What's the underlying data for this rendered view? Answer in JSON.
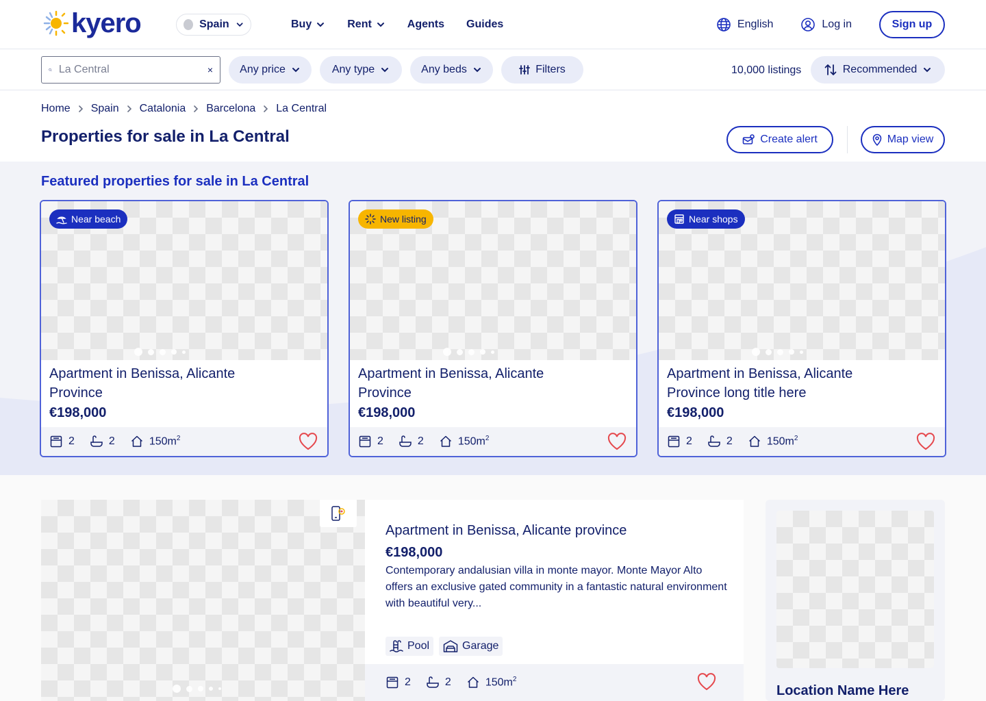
{
  "header": {
    "logo": "kyero",
    "country": "Spain",
    "nav": [
      {
        "label": "Buy",
        "has_dropdown": true
      },
      {
        "label": "Rent",
        "has_dropdown": true
      },
      {
        "label": "Agents",
        "has_dropdown": false
      },
      {
        "label": "Guides",
        "has_dropdown": false
      }
    ],
    "language": "English",
    "login": "Log in",
    "signup": "Sign up"
  },
  "filters": {
    "search_value": "La Central",
    "clear": "×",
    "price": "Any price",
    "type": "Any type",
    "beds": "Any beds",
    "more": "Filters",
    "count": "10,000 listings",
    "sort": "Recommended"
  },
  "breadcrumb": [
    "Home",
    "Spain",
    "Catalonia",
    "Barcelona",
    "La Central"
  ],
  "page_title": "Properties for sale in La Central",
  "actions": {
    "create_alert": "Create alert",
    "map_view": "Map view"
  },
  "featured": {
    "title": "Featured properties for sale in La Central",
    "cards": [
      {
        "badge": "Near beach",
        "badge_color": "#1b2fbf",
        "badge_icon": "beach-icon",
        "title": "Apartment in Benissa, Alicante Province",
        "price": "€198,000",
        "beds": "2",
        "baths": "2",
        "area": "150m",
        "area_unit_sup": "2"
      },
      {
        "badge": "New listing",
        "badge_color": "#f7b500",
        "badge_icon": "sparkle-icon",
        "title": "Apartment in Benissa, Alicante Province",
        "price": "€198,000",
        "beds": "2",
        "baths": "2",
        "area": "150m",
        "area_unit_sup": "2"
      },
      {
        "badge": "Near shops",
        "badge_color": "#1b2fbf",
        "badge_icon": "shop-icon",
        "title": "Apartment in Benissa, Alicante Province long title here",
        "price": "€198,000",
        "beds": "2",
        "baths": "2",
        "area": "150m",
        "area_unit_sup": "2"
      }
    ]
  },
  "listing": {
    "title": "Apartment in Benissa, Alicante province",
    "price": "€198,000",
    "description": "Contemporary andalusian villa in monte mayor. Monte Mayor Alto offers an exclusive gated community in a fantastic natural environment with beautiful very...",
    "tags": [
      "Pool",
      "Garage"
    ],
    "beds": "2",
    "baths": "2",
    "area": "150m",
    "area_unit_sup": "2"
  },
  "side_card": {
    "title": "Location Name Here"
  },
  "colors": {
    "brand": "#1b2fbf",
    "navy": "#13206b",
    "heart": "#e5484d",
    "pill_bg": "#e9ecf8",
    "band_bg": "#f2f3f8"
  }
}
